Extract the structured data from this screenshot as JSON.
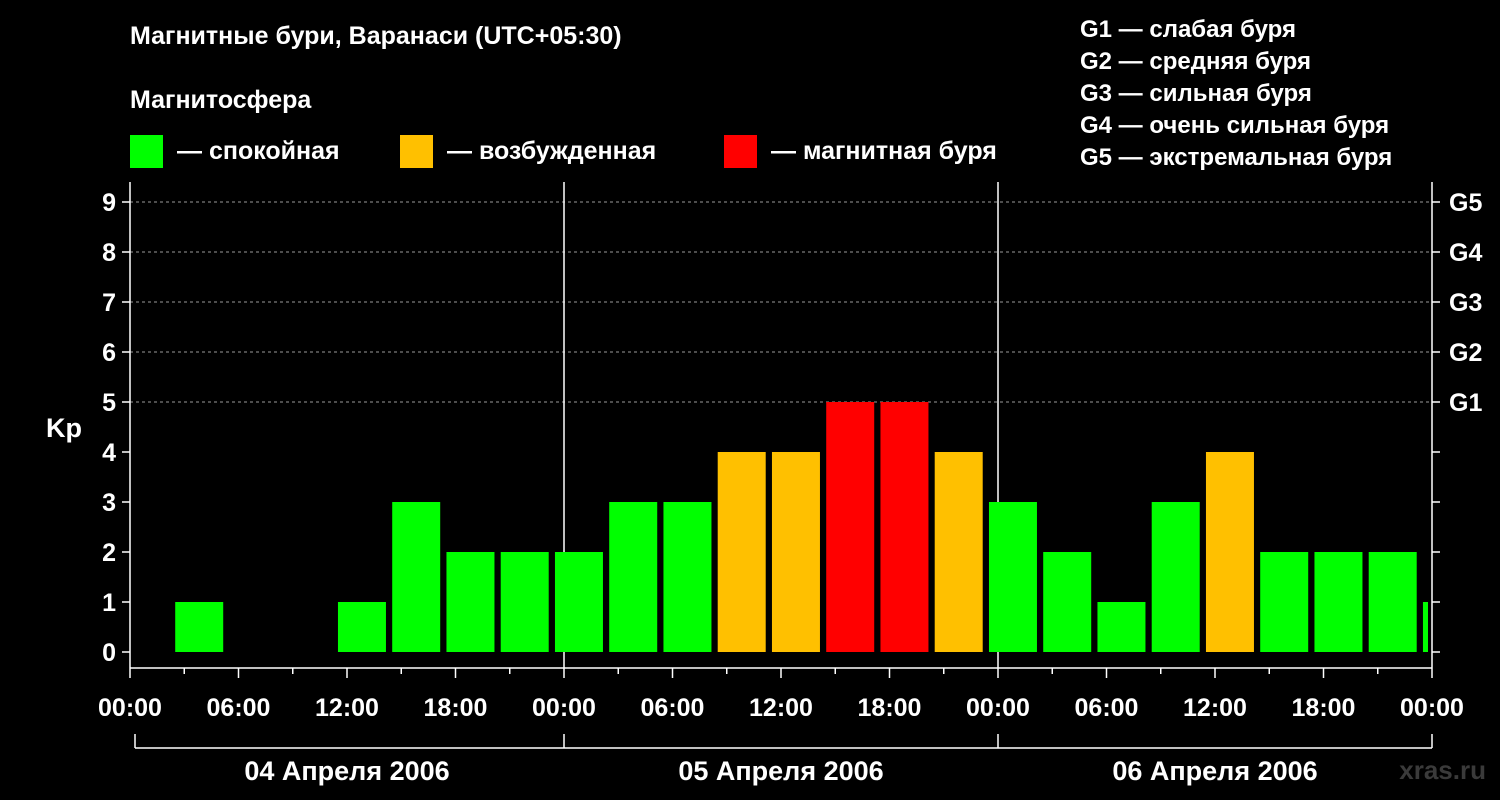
{
  "title": "Магнитные бури, Варанаси (UTC+05:30)",
  "subtitle": "Магнитосфера",
  "legend": [
    {
      "label": "— спокойная",
      "color": "#00ff00"
    },
    {
      "label": "— возбужденная",
      "color": "#ffc000"
    },
    {
      "label": "— магнитная буря",
      "color": "#ff0000"
    }
  ],
  "g_legend": [
    "G1 — слабая буря",
    "G2 — средняя буря",
    "G3 — сильная буря",
    "G4 — очень сильная буря",
    "G5 — экстремальная буря"
  ],
  "watermark": "xras.ru",
  "chart_data": {
    "type": "bar",
    "ylabel": "Kp",
    "ylim": [
      0,
      9
    ],
    "yticks": [
      0,
      1,
      2,
      3,
      4,
      5,
      6,
      7,
      8,
      9
    ],
    "y2_labels": [
      {
        "value": 5,
        "label": "G1"
      },
      {
        "value": 6,
        "label": "G2"
      },
      {
        "value": 7,
        "label": "G3"
      },
      {
        "value": 8,
        "label": "G4"
      },
      {
        "value": 9,
        "label": "G5"
      }
    ],
    "grid": "horizontal dashed at integer Kp 5–9",
    "x_range_hours": [
      0,
      72
    ],
    "x_ticks": [
      {
        "hour": 0,
        "label": "00:00"
      },
      {
        "hour": 6,
        "label": "06:00"
      },
      {
        "hour": 12,
        "label": "12:00"
      },
      {
        "hour": 18,
        "label": "18:00"
      },
      {
        "hour": 24,
        "label": "00:00"
      },
      {
        "hour": 30,
        "label": "06:00"
      },
      {
        "hour": 36,
        "label": "12:00"
      },
      {
        "hour": 42,
        "label": "18:00"
      },
      {
        "hour": 48,
        "label": "00:00"
      },
      {
        "hour": 54,
        "label": "06:00"
      },
      {
        "hour": 60,
        "label": "12:00"
      },
      {
        "hour": 66,
        "label": "18:00"
      },
      {
        "hour": 72,
        "label": "00:00"
      }
    ],
    "dates": [
      {
        "label": "04 Апреля 2006",
        "start_hour": 0,
        "end_hour": 24
      },
      {
        "label": "05 Апреля 2006",
        "start_hour": 24,
        "end_hour": 48
      },
      {
        "label": "06 Апреля 2006",
        "start_hour": 48,
        "end_hour": 72
      }
    ],
    "day_dividers_hours": [
      24,
      48
    ],
    "bars": [
      {
        "start_hour": 2.5,
        "kp": 1,
        "state": "quiet"
      },
      {
        "start_hour": 11.5,
        "kp": 1,
        "state": "quiet"
      },
      {
        "start_hour": 14.5,
        "kp": 3,
        "state": "quiet"
      },
      {
        "start_hour": 17.5,
        "kp": 2,
        "state": "quiet"
      },
      {
        "start_hour": 20.5,
        "kp": 2,
        "state": "quiet"
      },
      {
        "start_hour": 23.5,
        "kp": 2,
        "state": "quiet"
      },
      {
        "start_hour": 26.5,
        "kp": 3,
        "state": "quiet"
      },
      {
        "start_hour": 29.5,
        "kp": 3,
        "state": "quiet"
      },
      {
        "start_hour": 32.5,
        "kp": 4,
        "state": "active"
      },
      {
        "start_hour": 35.5,
        "kp": 4,
        "state": "active"
      },
      {
        "start_hour": 38.5,
        "kp": 5,
        "state": "storm"
      },
      {
        "start_hour": 41.5,
        "kp": 5,
        "state": "storm"
      },
      {
        "start_hour": 44.5,
        "kp": 4,
        "state": "active"
      },
      {
        "start_hour": 47.5,
        "kp": 3,
        "state": "quiet"
      },
      {
        "start_hour": 50.5,
        "kp": 2,
        "state": "quiet"
      },
      {
        "start_hour": 53.5,
        "kp": 1,
        "state": "quiet"
      },
      {
        "start_hour": 56.5,
        "kp": 3,
        "state": "quiet"
      },
      {
        "start_hour": 59.5,
        "kp": 4,
        "state": "active"
      },
      {
        "start_hour": 62.5,
        "kp": 2,
        "state": "quiet"
      },
      {
        "start_hour": 65.5,
        "kp": 2,
        "state": "quiet"
      },
      {
        "start_hour": 68.5,
        "kp": 2,
        "state": "quiet"
      },
      {
        "start_hour": 71.5,
        "kp": 1,
        "state": "quiet"
      }
    ],
    "state_colors": {
      "quiet": "#00ff00",
      "active": "#ffc000",
      "storm": "#ff0000"
    }
  }
}
